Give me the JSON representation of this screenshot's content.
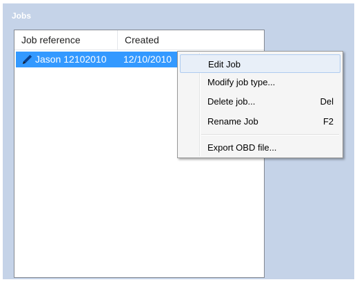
{
  "panel": {
    "title": "Jobs"
  },
  "list": {
    "columns": [
      {
        "label": "Job reference"
      },
      {
        "label": "Created"
      }
    ],
    "rows": [
      {
        "reference": "Jason 12102010",
        "created": "12/10/2010",
        "icon": "pencil-icon",
        "selected": true
      }
    ]
  },
  "context_menu": {
    "items": [
      {
        "label": "Edit Job",
        "shortcut": ""
      },
      {
        "label": "Modify job type...",
        "shortcut": ""
      },
      {
        "label": "Delete job...",
        "shortcut": "Del"
      },
      {
        "label": "Rename Job",
        "shortcut": "F2"
      },
      {
        "label": "Export OBD file...",
        "shortcut": ""
      }
    ]
  },
  "colors": {
    "panel_background": "#c5d3e8",
    "selection": "#3399ff",
    "menu_highlight": "#e8eff8"
  }
}
